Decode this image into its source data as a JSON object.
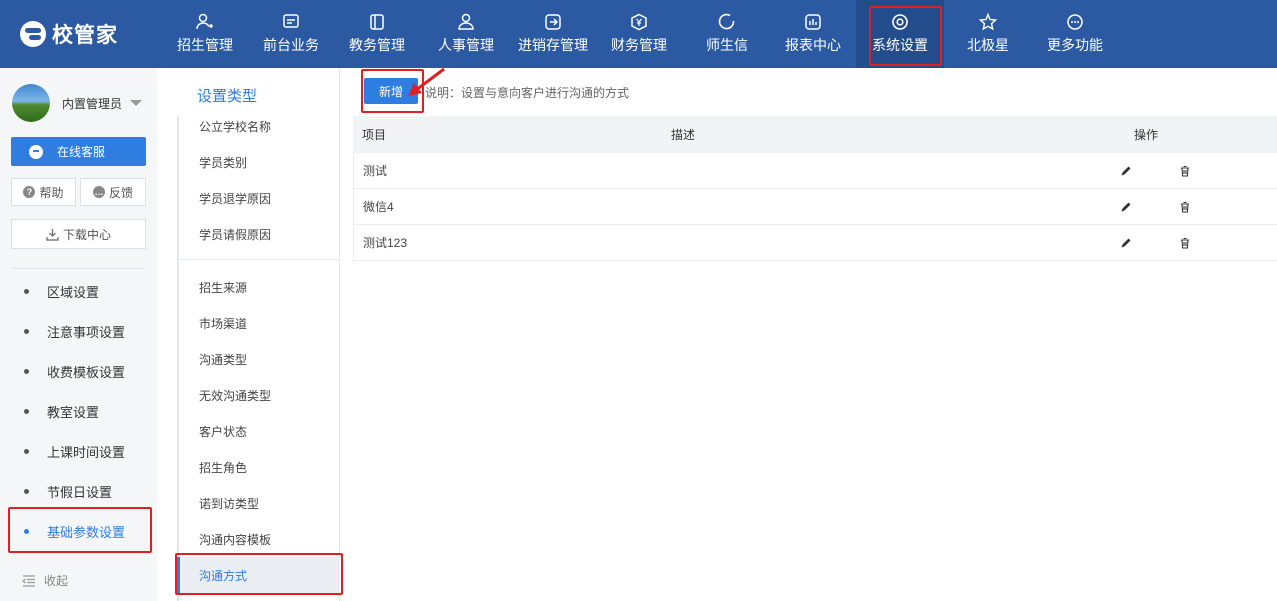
{
  "app": {
    "logo_text": "校管家"
  },
  "topnav": {
    "items": [
      {
        "label": "招生管理",
        "icon": "user-add-icon"
      },
      {
        "label": "前台业务",
        "icon": "monitor-icon"
      },
      {
        "label": "教务管理",
        "icon": "book-icon"
      },
      {
        "label": "人事管理",
        "icon": "person-icon"
      },
      {
        "label": "进销存管理",
        "icon": "login-icon"
      },
      {
        "label": "财务管理",
        "icon": "yuan-icon"
      },
      {
        "label": "师生信",
        "icon": "circle-icon"
      },
      {
        "label": "报表中心",
        "icon": "chart-icon"
      },
      {
        "label": "系统设置",
        "icon": "gear-icon",
        "active": true
      },
      {
        "label": "北极星",
        "icon": "star-icon"
      },
      {
        "label": "更多功能",
        "icon": "more-icon"
      }
    ]
  },
  "sidebar": {
    "user_name": "内置管理员",
    "online_service": "在线客服",
    "help": "帮助",
    "feedback": "反馈",
    "download_center": "下载中心",
    "menu": [
      {
        "label": "区域设置"
      },
      {
        "label": "注意事项设置"
      },
      {
        "label": "收费模板设置"
      },
      {
        "label": "教室设置"
      },
      {
        "label": "上课时间设置"
      },
      {
        "label": "节假日设置"
      },
      {
        "label": "基础参数设置",
        "active": true
      }
    ],
    "collapse": "收起"
  },
  "types": {
    "title": "设置类型",
    "items": [
      "公立学校名称",
      "学员类别",
      "学员退学原因",
      "学员请假原因",
      "招生来源",
      "市场渠道",
      "沟通类型",
      "无效沟通类型",
      "客户状态",
      "招生角色",
      "诺到访类型",
      "沟通内容模板",
      "沟通方式"
    ],
    "active": "沟通方式"
  },
  "main": {
    "add_button": "新增",
    "note": "说明：设置与意向客户进行沟通的方式",
    "columns": {
      "item": "项目",
      "desc": "描述",
      "op": "操作"
    },
    "rows": [
      {
        "item": "测试",
        "desc": ""
      },
      {
        "item": "微信4",
        "desc": ""
      },
      {
        "item": "测试123",
        "desc": ""
      }
    ]
  },
  "colors": {
    "topbar": "#2b5aa3",
    "accent": "#2f7de1",
    "annotation": "#e02020"
  }
}
